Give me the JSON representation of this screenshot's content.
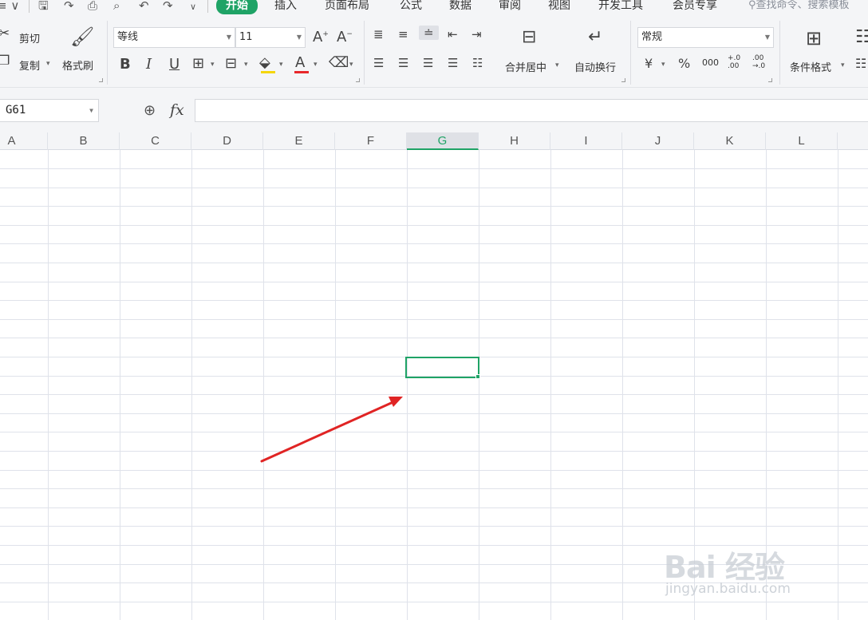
{
  "menubar": {
    "menu_glyph": "≡ ∨",
    "quick_icons": [
      "save-icon",
      "redo-save-icon",
      "print-icon",
      "print-preview-icon",
      "undo-icon",
      "redo-icon",
      "more-icon"
    ],
    "tabs": [
      {
        "label": "开始",
        "active": true
      },
      {
        "label": "插入"
      },
      {
        "label": "页面布局"
      },
      {
        "label": "公式"
      },
      {
        "label": "数据"
      },
      {
        "label": "审阅"
      },
      {
        "label": "视图"
      },
      {
        "label": "开发工具"
      },
      {
        "label": "会员专享"
      }
    ],
    "search_placeholder": "查找命令、搜索模板"
  },
  "ribbon": {
    "cut_label": "剪切",
    "copy_label": "复制",
    "format_painter_label": "格式刷",
    "font_name": "等线",
    "font_size": "11",
    "bold": "B",
    "italic": "I",
    "underline": "U",
    "font_color_letter": "A",
    "merge_center_label": "合并居中",
    "wrap_text_label": "自动换行",
    "number_format": "常规",
    "currency_symbol": "¥",
    "percent_symbol": "%",
    "thousands_symbol": "000",
    "increase_decimal": "+.0 .00",
    "decrease_decimal": ".00 →.0",
    "conditional_format_label": "条件格式"
  },
  "formula_bar": {
    "cell_reference": "G61",
    "fx_label": "fx",
    "formula_value": ""
  },
  "sheet": {
    "columns": [
      "A",
      "B",
      "C",
      "D",
      "E",
      "F",
      "G",
      "H",
      "I",
      "J",
      "K",
      "L"
    ],
    "selected_column": "G",
    "active_cell": "G61"
  },
  "colors": {
    "accent_green": "#1fa366",
    "annotation_arrow": "#e02424",
    "grid_line": "#dfe2ea"
  },
  "watermark": {
    "logo_text": "Bai 经验",
    "url": "jingyan.baidu.com"
  }
}
